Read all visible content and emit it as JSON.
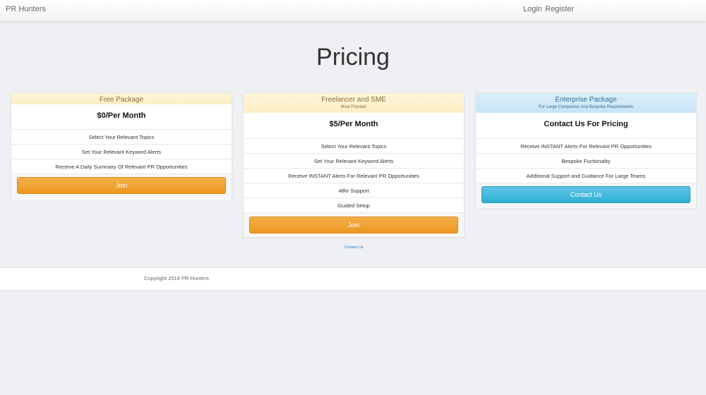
{
  "nav": {
    "brand": "PR Hunters",
    "login": "Login",
    "register": "Register"
  },
  "page": {
    "title": "Pricing"
  },
  "plans": [
    {
      "name": "Free Package",
      "subtitle": "",
      "price": "$0/Per Month",
      "features": [
        "Select Your Relevant Topics",
        "Set Your Relevant Keyword Alerts",
        "Receive A Daily Summary Of Relevant PR Opportunities"
      ],
      "button": "Join"
    },
    {
      "name": "Freelancer and SME",
      "subtitle": "Most Popular!",
      "price": "$5/Per Month",
      "features": [
        "Select Your Relevant Topics",
        "Set Your Relevant Keyword Alerts",
        "Receive INSTANT Alerts For Relevant PR Opportunities",
        "48hr Support",
        "Guided Setup"
      ],
      "button": "Join"
    },
    {
      "name": "Enterprise Package",
      "subtitle": "For Large Companies And Bespoke Requirements",
      "price": "Contact Us For Pricing",
      "features": [
        "Receive INSTANT Alerts For Relevant PR Opportunities",
        "Bespoke Fuctionality",
        "Additional Support and Guidance For Large Teams"
      ],
      "button": "Contact Us"
    }
  ],
  "contact_link": "Contact Us",
  "footer": {
    "copyright": "Copyright 2018 PR Hunters"
  },
  "colors": {
    "accent_orange": "#ec971f",
    "accent_blue": "#31b0d5",
    "header_gold": "#fcefc4",
    "header_blue": "#c8e4f6"
  }
}
